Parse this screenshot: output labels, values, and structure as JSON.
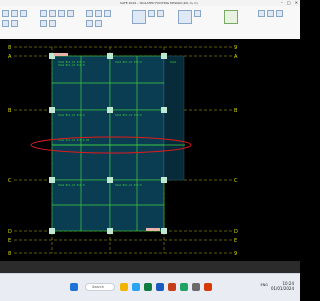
{
  "window": {
    "title": "SAFE 2016 – ISOLATED FOOTING DESIGN (kN, m, C)",
    "min": "–",
    "max": "□",
    "close": "✕"
  },
  "ribbon": {
    "groups": [
      "Model Explorer",
      "View",
      "Define",
      "Draw",
      "Assign",
      "Run",
      "Display",
      "Detailing"
    ]
  },
  "grid": {
    "top_labels": [
      "8",
      "9"
    ],
    "left_labels": [
      "A",
      "B",
      "C",
      "D",
      "E"
    ],
    "right_labels": [
      "A",
      "B",
      "C",
      "D",
      "E"
    ],
    "bottom_labels": [
      "8",
      "9"
    ]
  },
  "annotations": {
    "strip_label": "CSA1  B=1.21 X=0.0",
    "strip_text": "CSA1  D=1.21 X=0.0 00"
  },
  "taskbar": {
    "search_placeholder": "Search",
    "language": "ENG",
    "time": "10:24",
    "date": "01/01/2024"
  },
  "colors": {
    "grid": "#b8b800",
    "slab_fill": "#0b3d52",
    "strip_green": "#3fd03f",
    "column": "#bfe8d4",
    "highlight": "#e01a1a"
  }
}
